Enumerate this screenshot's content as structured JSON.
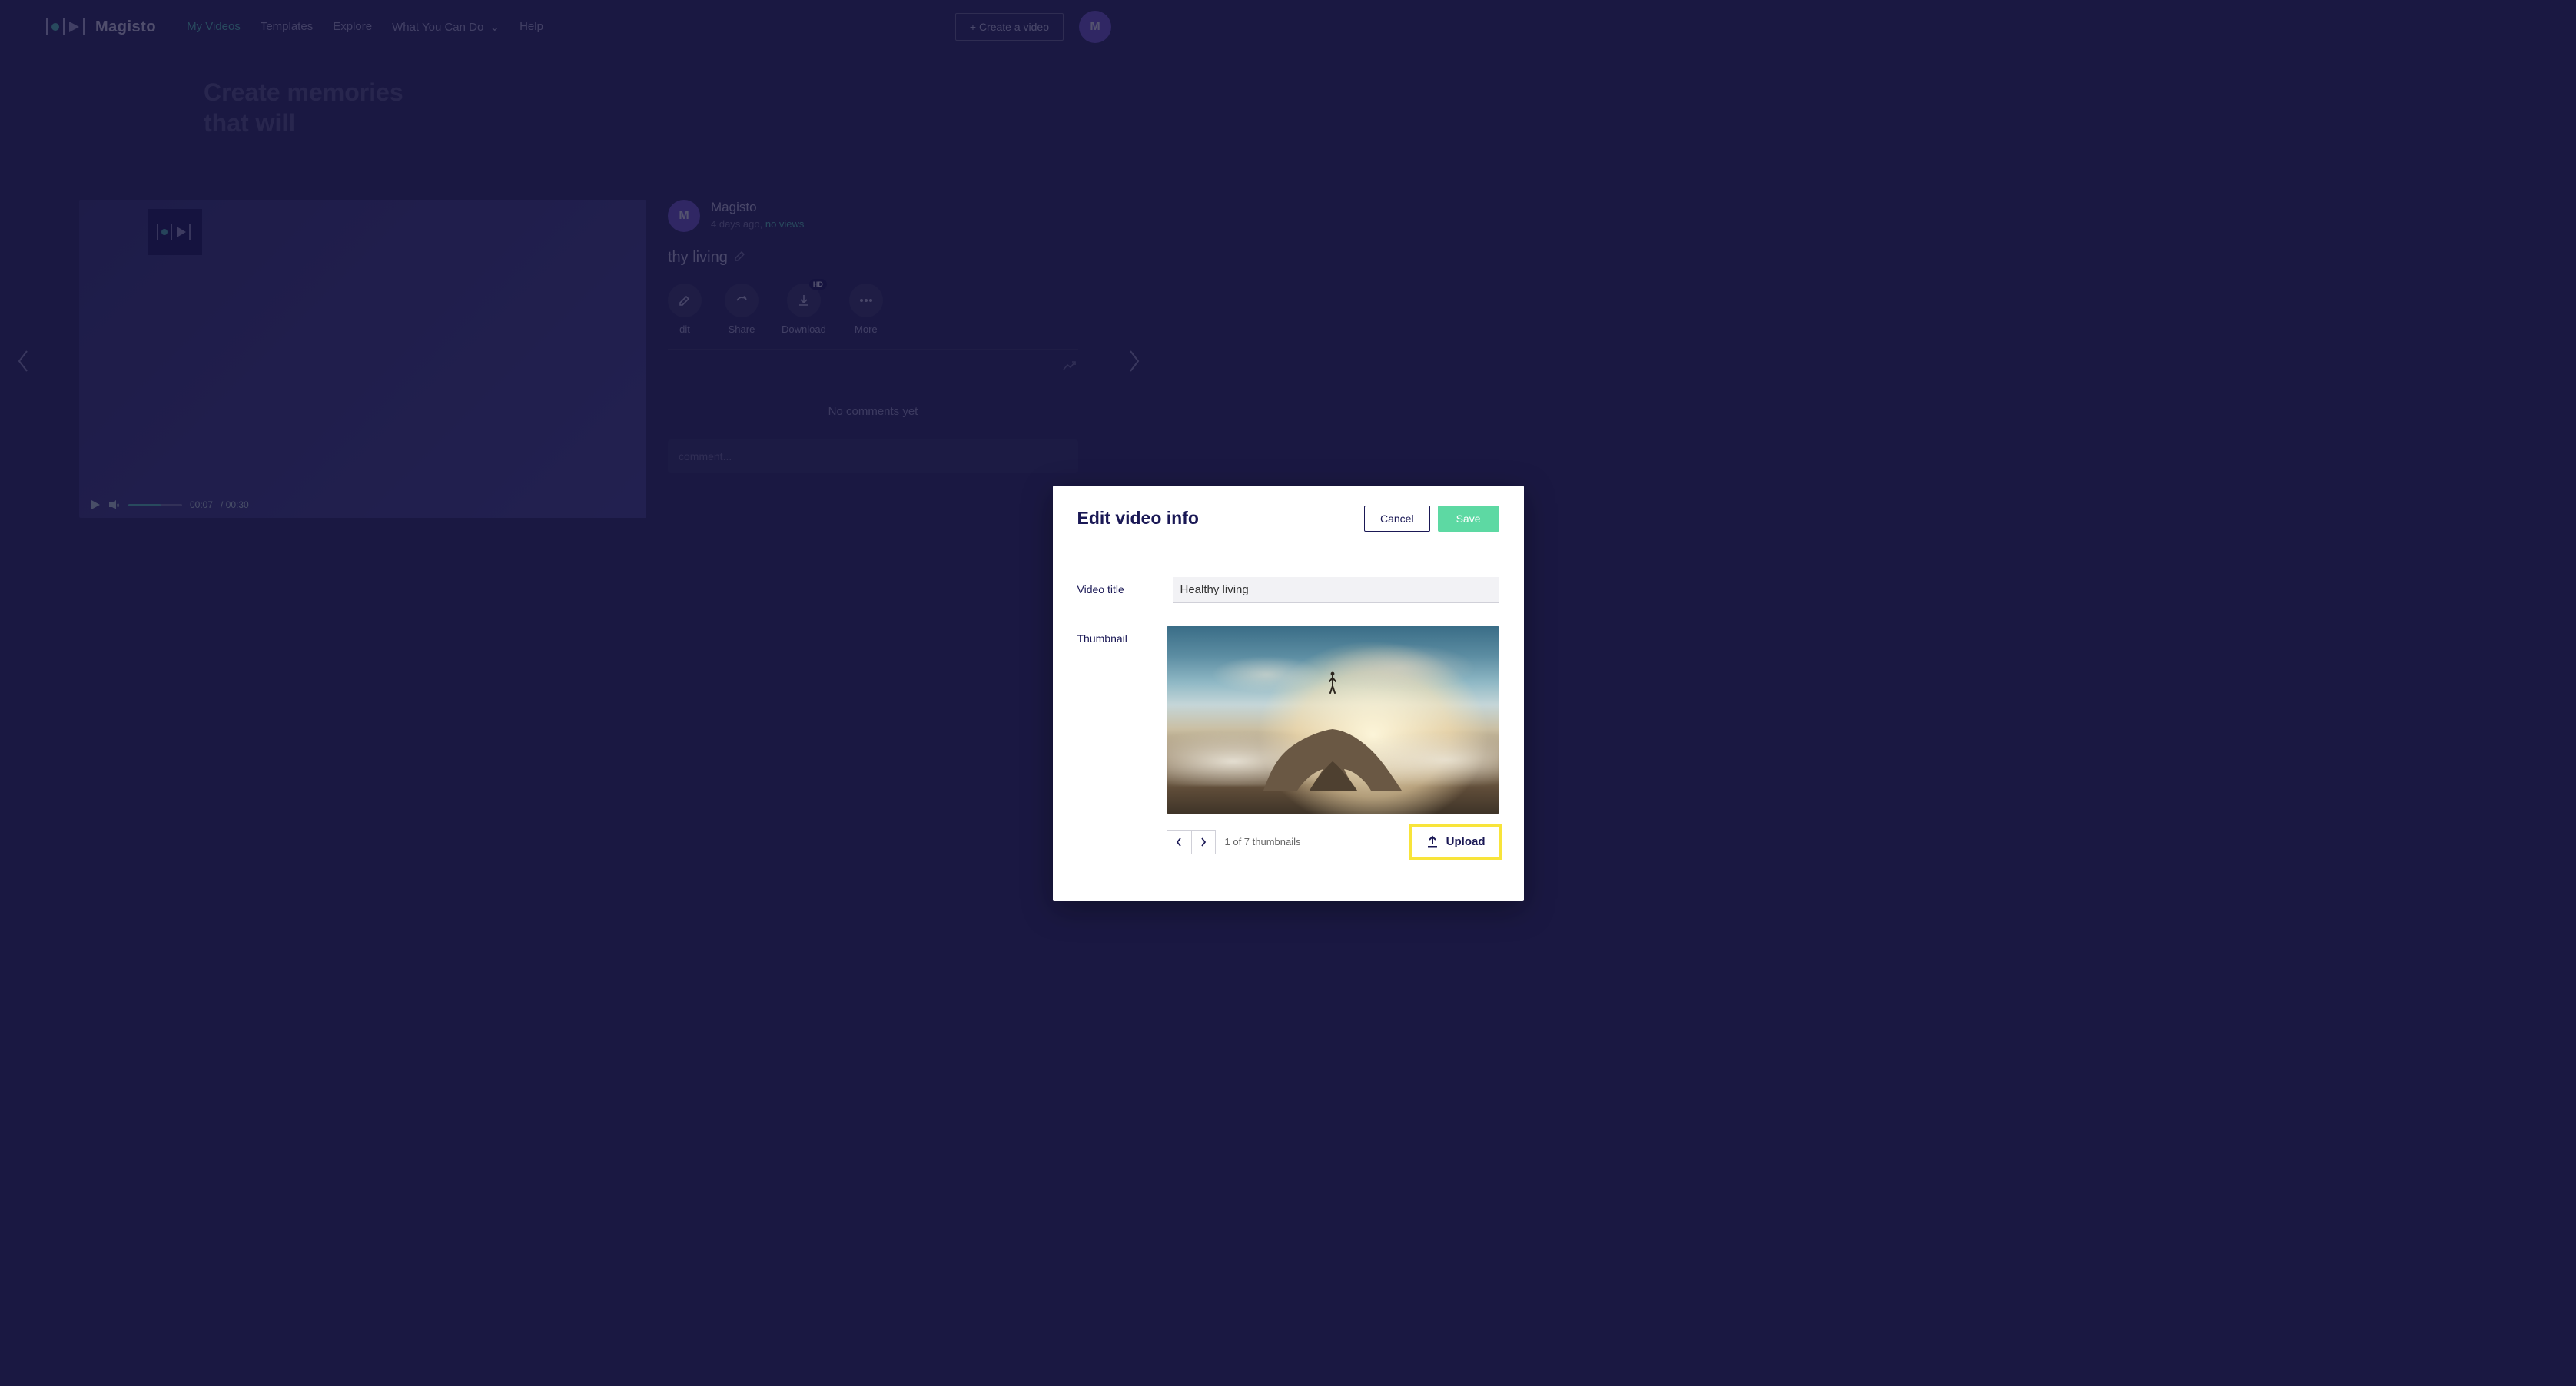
{
  "brand": "Magisto",
  "nav": {
    "my_videos": "My Videos",
    "templates": "Templates",
    "explore": "Explore",
    "what_you_can_do": "What You Can Do",
    "help": "Help"
  },
  "create_video_label": "+ Create a video",
  "avatar_initial": "M",
  "hero": "Create memories\nthat will",
  "video": {
    "current_time": "00:07",
    "duration": "/ 00:30"
  },
  "side": {
    "owner": "Magisto",
    "age": "4 days ago,",
    "views": "no views",
    "title": "thy living",
    "actions": {
      "edit": "dit",
      "share": "Share",
      "download": "Download",
      "more": "More"
    },
    "hd_badge": "HD",
    "no_comments": "No comments yet",
    "comment_placeholder": "comment..."
  },
  "modal": {
    "title": "Edit video info",
    "cancel": "Cancel",
    "save": "Save",
    "video_title_label": "Video title",
    "video_title_value": "Healthy living",
    "thumbnail_label": "Thumbnail",
    "thumb_counter": "1 of 7 thumbnails",
    "upload": "Upload"
  }
}
